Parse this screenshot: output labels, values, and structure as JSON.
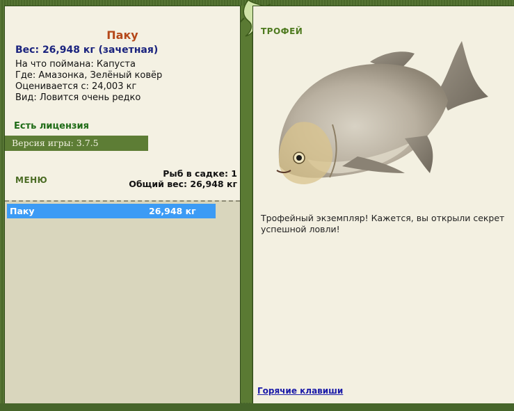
{
  "fish": {
    "name": "Паку",
    "weight_line": "Вес: 26,948 кг (зачетная)",
    "caught_on": "На что поймана: Капуста",
    "location": "Где: Амазонка, Зелёный ковёр",
    "valued_from": "Оценивается с: 24,003 кг",
    "kind": "Вид: Ловится очень редко"
  },
  "license": "Есть лицензия",
  "version": "Версия игры: 3.7.5",
  "menu_label": "МЕНЮ",
  "cage": {
    "count_line": "Рыб в садке: 1",
    "total_line": "Общий вес: 26,948 кг"
  },
  "catch_list": [
    {
      "name": "Паку",
      "weight": "26,948 кг"
    }
  ],
  "trophy": {
    "label": "ТРОФЕЙ",
    "text": "Трофейный экземпляр! Кажется, вы открыли секрет успешной ловли!"
  },
  "hotkeys_link": "Горячие клавиши",
  "colors": {
    "frame": "#4f6f2c",
    "panel": "#f3f0e1",
    "list_bg": "#d9d6bd",
    "selected_row": "#3c9bf5",
    "title": "#b5481a",
    "weight": "#1a237e",
    "license": "#1e6b16"
  }
}
